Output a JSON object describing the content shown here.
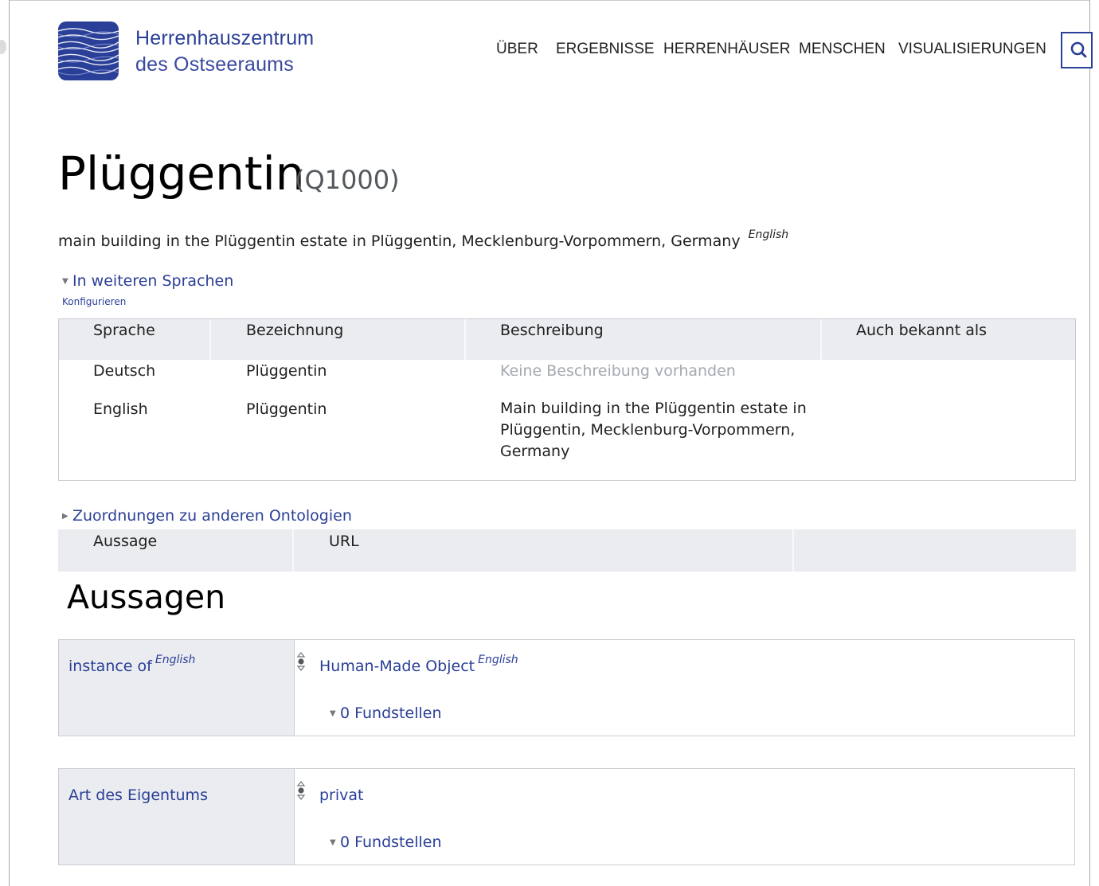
{
  "header": {
    "brand_line1": "Herrenhauszentrum",
    "brand_line2": "des Ostseeraums",
    "nav": [
      "ÜBER",
      "ERGEBNISSE",
      "HERRENHÄUSER",
      "MENSCHEN",
      "VISUALISIERUNGEN"
    ],
    "search_icon": "search-icon",
    "accent_color": "#2a3f97"
  },
  "page": {
    "title": "Plüggentin",
    "id": "(Q1000)",
    "description": "main building in the Plüggentin estate in Plüggentin, Mecklenburg-Vorpommern, Germany",
    "description_lang": "English"
  },
  "languages": {
    "toggle_label": "In weiteren Sprachen",
    "configure_label": "Konfigurieren",
    "columns": [
      "Sprache",
      "Bezeichnung",
      "Beschreibung",
      "Auch bekannt als"
    ],
    "rows": [
      {
        "language": "Deutsch",
        "label": "Plüggentin",
        "description": "Keine Beschreibung vorhanden",
        "aliases": ""
      },
      {
        "language": "English",
        "label": "Plüggentin",
        "description": "Main building in the Plüggentin estate in Plüggentin, Mecklenburg-Vorpommern, Germany",
        "aliases": ""
      }
    ]
  },
  "mappings": {
    "toggle_label": "Zuordnungen zu anderen Ontologien",
    "columns": [
      "Aussage",
      "URL",
      ""
    ]
  },
  "statements": {
    "title": "Aussagen",
    "items": [
      {
        "property": "instance of",
        "property_lang": "English",
        "value": "Human-Made Object",
        "value_lang": "English",
        "references": "0 Fundstellen"
      },
      {
        "property": "Art des Eigentums",
        "property_lang": "",
        "value": "privat",
        "value_lang": "",
        "references": "0 Fundstellen"
      }
    ]
  }
}
